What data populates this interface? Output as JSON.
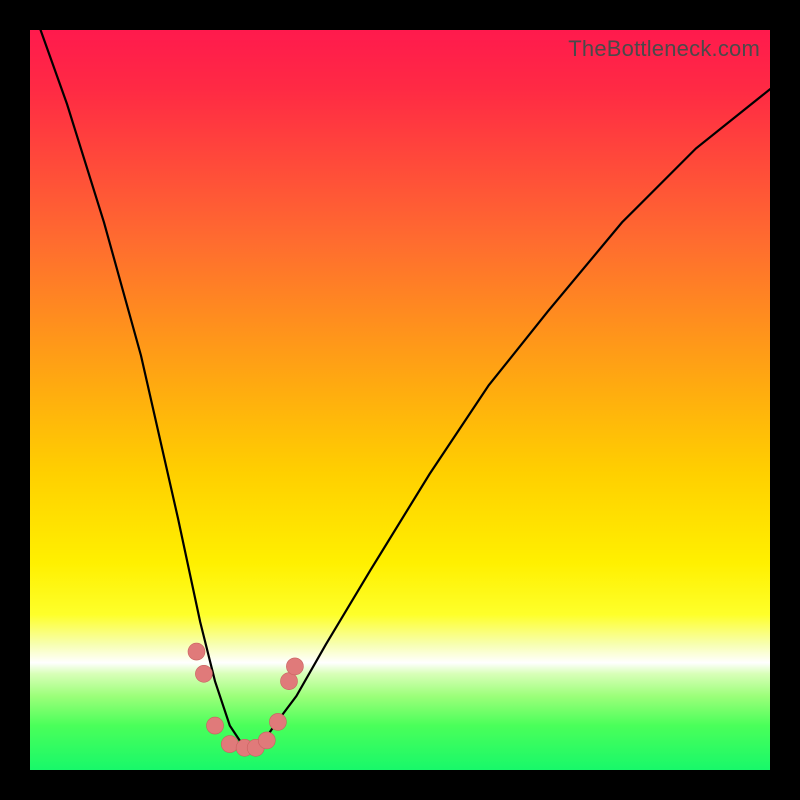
{
  "attribution": "TheBottleneck.com",
  "colors": {
    "frame": "#000000",
    "gradient_top": "#ff1a4d",
    "gradient_bottom": "#18f86a",
    "curve": "#000000",
    "markers": "#e07a7a"
  },
  "chart_data": {
    "type": "line",
    "title": "",
    "xlabel": "",
    "ylabel": "",
    "xlim": [
      0,
      100
    ],
    "ylim": [
      0,
      100
    ],
    "grid": false,
    "legend": false,
    "notes": "Bottleneck-style curve: steep descent from upper-left to a minimum near x≈29, then a shallower rise toward the upper-right. Background heat-gradient runs red (top, high bottleneck) to green (bottom, low bottleneck) with a thin white band near the bottom. Salmon dots mark the near-minimum region. Axes are unlabeled.",
    "series": [
      {
        "name": "bottleneck-curve",
        "x": [
          0,
          5,
          10,
          15,
          20,
          23,
          25,
          27,
          29,
          31,
          33,
          36,
          40,
          46,
          54,
          62,
          70,
          80,
          90,
          100
        ],
        "y": [
          104,
          90,
          74,
          56,
          34,
          20,
          12,
          6,
          3,
          3,
          6,
          10,
          17,
          27,
          40,
          52,
          62,
          74,
          84,
          92
        ]
      }
    ],
    "markers": [
      {
        "x": 22.5,
        "y": 16
      },
      {
        "x": 23.5,
        "y": 13
      },
      {
        "x": 25.0,
        "y": 6
      },
      {
        "x": 27.0,
        "y": 3.5
      },
      {
        "x": 29.0,
        "y": 3
      },
      {
        "x": 30.5,
        "y": 3
      },
      {
        "x": 32.0,
        "y": 4
      },
      {
        "x": 33.5,
        "y": 6.5
      },
      {
        "x": 35.0,
        "y": 12
      },
      {
        "x": 35.8,
        "y": 14
      }
    ]
  }
}
